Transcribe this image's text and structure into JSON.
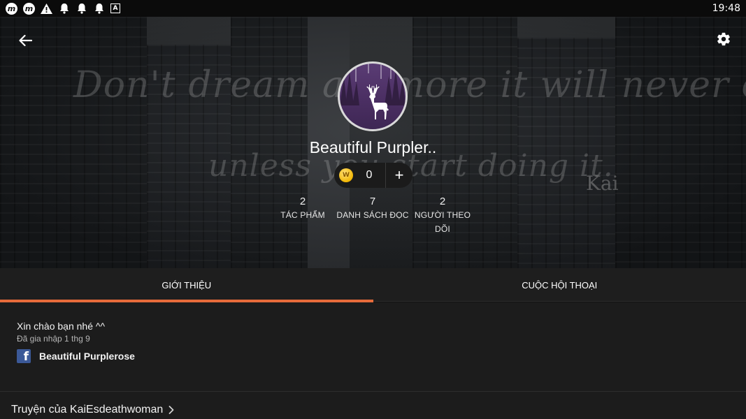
{
  "status_bar": {
    "time": "19:48",
    "icons": [
      "m-app-icon",
      "m-app-icon",
      "warning-icon",
      "bell-icon",
      "bell-icon",
      "bell-icon",
      "a-app-icon"
    ]
  },
  "header": {
    "quote_line1": "Don't dream anymore it will never come true",
    "quote_line2": "unless you start doing it.",
    "signature": "Kai",
    "back_icon": "arrow-left-icon",
    "settings_icon": "gear-icon"
  },
  "profile": {
    "username": "Beautiful Purpler..",
    "coins": "0",
    "coin_symbol": "W",
    "add_symbol": "+",
    "stats": [
      {
        "value": "2",
        "label": "TÁC PHẨM"
      },
      {
        "value": "7",
        "label": "DANH SÁCH ĐỌC"
      },
      {
        "value": "2",
        "label": "NGƯỜI THEO DÕI"
      }
    ]
  },
  "tabs": [
    {
      "label": "GIỚI THIỆU",
      "active": true
    },
    {
      "label": "CUỘC HỘI THOẠI",
      "active": false
    }
  ],
  "about": {
    "bio": "Xin chào bạn nhé ^^",
    "joined": "Đã gia nhập 1 thg 9",
    "facebook_name": "Beautiful Purplerose"
  },
  "stories": {
    "title": "Truyện của KaiEsdeathwoman"
  },
  "colors": {
    "accent": "#e66b3b",
    "facebook": "#3b5998",
    "coin": "#f2b705",
    "background": "#121212"
  }
}
